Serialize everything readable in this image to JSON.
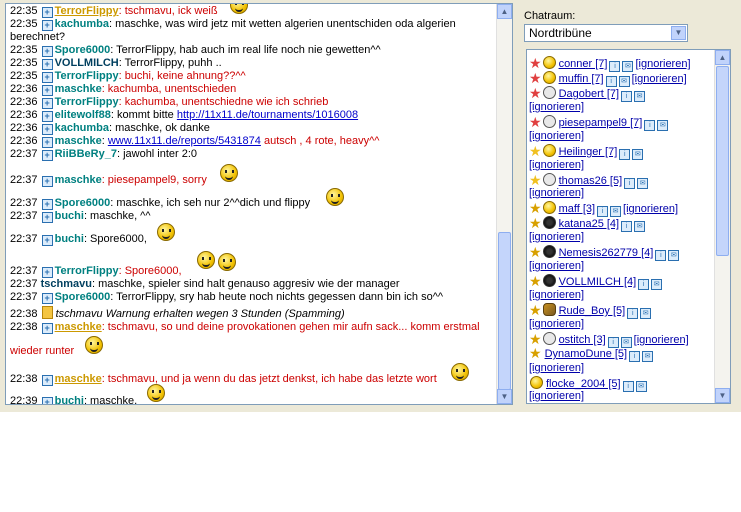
{
  "chat": {
    "lines": [
      {
        "time": "22:35",
        "nick": "TerrorFlippy",
        "text": ": tschmavu, ick weiß"
      },
      {
        "time": "22:35",
        "nick": "kachumba",
        "text": ": maschke, was wird jetz mit wetten algerien unentschiden oda algerien"
      },
      {
        "text": "berechnet?"
      },
      {
        "time": "22:35",
        "nick": "Spore6000",
        "text": ": TerrorFlippy, hab auch im real life noch nie gewetten^^"
      },
      {
        "time": "22:35",
        "nick": "VOLLMILCH",
        "text": ": TerrorFlippy, puhh .."
      },
      {
        "time": "22:35",
        "nick": "TerrorFlippy",
        "text": ": buchi, keine ahnung??^^"
      },
      {
        "time": "22:36",
        "nick": "maschke",
        "text": ": kachumba, unentschieden"
      },
      {
        "time": "22:36",
        "nick": "TerrorFlippy",
        "text": ": kachumba, unentschiedne wie ich schrieb"
      },
      {
        "time": "22:36",
        "nick": "elitewolf88",
        "text": ": kommt bitte ",
        "link": "http://11x11.de/tournaments/1016008"
      },
      {
        "time": "22:36",
        "nick": "kachumba",
        "text": ": maschke, ok danke"
      },
      {
        "time": "22:36",
        "nick": "maschke",
        "text": ": ",
        "link": "www.11x11.de/reports/5431874",
        "text2": " autsch , 4 rote, heavy^^"
      },
      {
        "time": "22:37",
        "nick": "RiiBBeRy_7",
        "text": ": jawohl inter 2:0"
      },
      {
        "time": "22:37",
        "nick": "maschke",
        "text": ": piesepampel9, sorry"
      },
      {
        "time": "22:37",
        "nick": "Spore6000",
        "text": ": maschke, ich seh nur 2^^dich und flippy"
      },
      {
        "time": "22:37",
        "nick": "buchi",
        "text": ": maschke, ^^"
      },
      {
        "time": "22:37",
        "nick": "buchi",
        "text": ": Spore6000,"
      },
      {
        "time": "22:37",
        "nick": "TerrorFlippy",
        "text": ": Spore6000,"
      },
      {
        "time": "22:37",
        "nick": "tschmavu",
        "text": ": maschke, spieler sind halt genauso aggresiv wie der manager"
      },
      {
        "time": "22:37",
        "nick": "Spore6000",
        "text": ": TerrorFlippy, sry hab heute noch nichts gegessen dann bin ich so^^"
      },
      {
        "time": "22:38",
        "text": "tschmavu Warnung erhalten wegen 3 Stunden (Spamming)"
      },
      {
        "time": "22:38",
        "nick": "maschke",
        "text": ": tschmavu, so und deine provokationen gehen mir aufn sack... komm erstmal"
      },
      {
        "text": "wieder runter"
      },
      {
        "time": "22:38",
        "nick": "maschke",
        "text": ": tschmavu, und ja wenn du das jetzt denkst, ich habe das letzte wort"
      },
      {
        "time": "22:39",
        "nick": "buchi",
        "text": ": maschke,"
      }
    ]
  },
  "room": {
    "label": "Chatraum:",
    "selected": "Nordtribüne"
  },
  "users": [
    {
      "name": "conner [7]",
      "ignore": "[ignorieren]"
    },
    {
      "name": "muffin [7]",
      "ignore": "[ignorieren]"
    },
    {
      "name": "Dagobert [7]",
      "ignore": "[ignorieren]"
    },
    {
      "name": "piesepampel9 [7]",
      "ignore": "[ignorieren]"
    },
    {
      "name": "Heilinger [7]",
      "ignore": "[ignorieren]"
    },
    {
      "name": "thomas26 [5]",
      "ignore": "[ignorieren]"
    },
    {
      "name": "maff [3]",
      "ignore": "[ignorieren]"
    },
    {
      "name": "katana25 [4]",
      "ignore": "[ignorieren]"
    },
    {
      "name": "Nemesis262779 [4]",
      "ignore": "[ignorieren]"
    },
    {
      "name": "VOLLMILCH [4]",
      "ignore": "[ignorieren]"
    },
    {
      "name": "Rude_Boy [5]",
      "ignore": "[ignorieren]"
    },
    {
      "name": "ostitch [3]",
      "ignore": "[ignorieren]"
    },
    {
      "name": "DynamoDune [5]",
      "ignore": "[ignorieren]"
    },
    {
      "name": "flocke_2004 [5]",
      "ignore": "[ignorieren]"
    }
  ]
}
